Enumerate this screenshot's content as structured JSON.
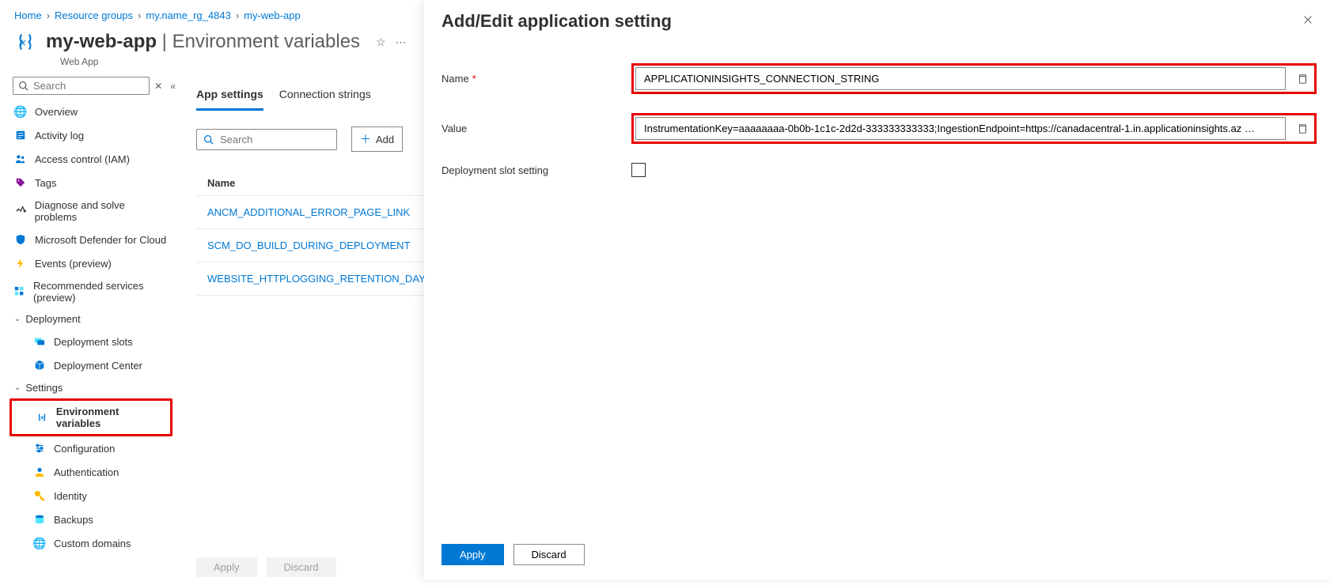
{
  "breadcrumb": [
    {
      "label": "Home"
    },
    {
      "label": "Resource groups"
    },
    {
      "label": "my.name_rg_4843"
    },
    {
      "label": "my-web-app"
    }
  ],
  "header": {
    "app_name": "my-web-app",
    "separator": " | ",
    "page_title": "Environment variables",
    "subtitle": "Web App"
  },
  "sidebar_search": {
    "placeholder": "Search"
  },
  "sidebar": {
    "items": [
      {
        "label": "Overview"
      },
      {
        "label": "Activity log"
      },
      {
        "label": "Access control (IAM)"
      },
      {
        "label": "Tags"
      },
      {
        "label": "Diagnose and solve problems"
      },
      {
        "label": "Microsoft Defender for Cloud"
      },
      {
        "label": "Events (preview)"
      },
      {
        "label": "Recommended services (preview)"
      }
    ],
    "deployment_label": "Deployment",
    "deployment": [
      {
        "label": "Deployment slots"
      },
      {
        "label": "Deployment Center"
      }
    ],
    "settings_label": "Settings",
    "settings": [
      {
        "label": "Environment variables"
      },
      {
        "label": "Configuration"
      },
      {
        "label": "Authentication"
      },
      {
        "label": "Identity"
      },
      {
        "label": "Backups"
      },
      {
        "label": "Custom domains"
      }
    ]
  },
  "tabs": [
    {
      "label": "App settings"
    },
    {
      "label": "Connection strings"
    }
  ],
  "toolbar": {
    "search_placeholder": "Search",
    "add_label": "Add"
  },
  "settings_table": {
    "header": "Name",
    "rows": [
      {
        "name": "ANCM_ADDITIONAL_ERROR_PAGE_LINK"
      },
      {
        "name": "SCM_DO_BUILD_DURING_DEPLOYMENT"
      },
      {
        "name": "WEBSITE_HTTPLOGGING_RETENTION_DAYS"
      }
    ]
  },
  "main_footer": {
    "apply": "Apply",
    "discard": "Discard"
  },
  "panel": {
    "title": "Add/Edit application setting",
    "name_label": "Name",
    "name_value": "APPLICATIONINSIGHTS_CONNECTION_STRING",
    "value_label": "Value",
    "value_value": "InstrumentationKey=aaaaaaaa-0b0b-1c1c-2d2d-333333333333;IngestionEndpoint=https://canadacentral-1.in.applicationinsights.az …",
    "slot_label": "Deployment slot setting",
    "apply": "Apply",
    "discard": "Discard"
  }
}
